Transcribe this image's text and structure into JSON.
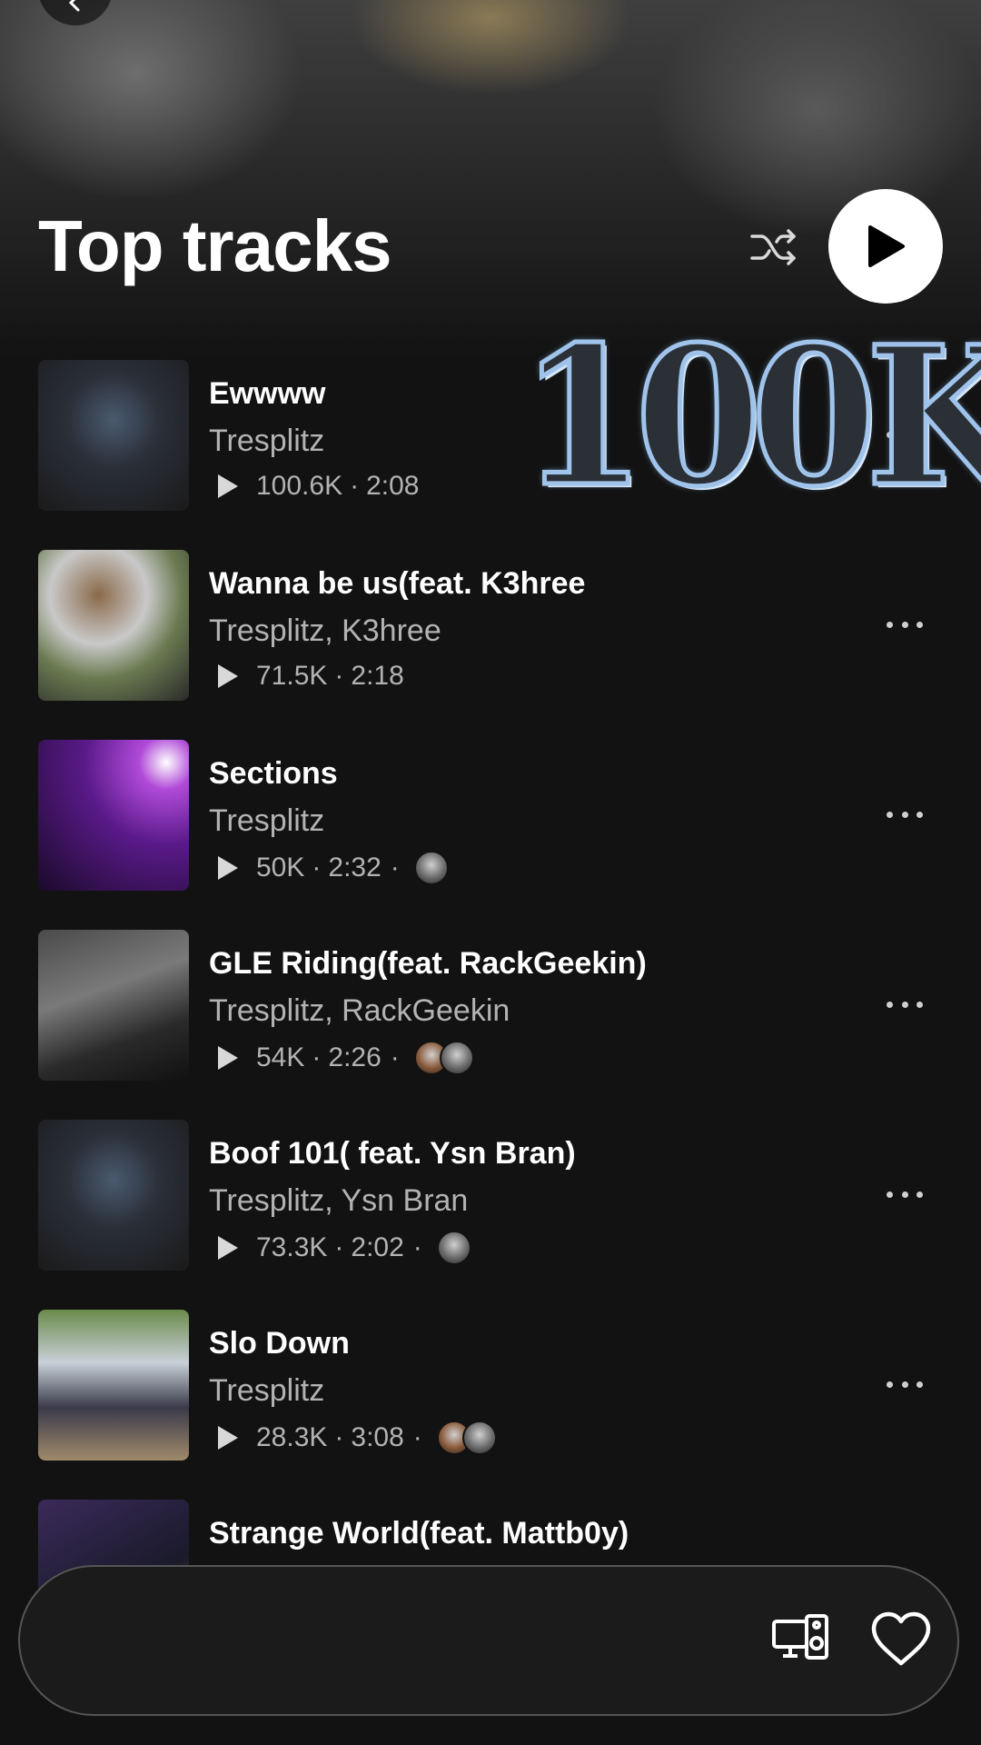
{
  "header": {
    "title": "Top tracks",
    "back_icon": "chevron-left-icon",
    "shuffle_icon": "shuffle-icon",
    "play_icon": "play-icon"
  },
  "sticker_text": "100K",
  "tracks": [
    {
      "title": "Ewwww",
      "artist": "Tresplitz",
      "plays": "100.6K",
      "duration": "2:08",
      "avatars": 0
    },
    {
      "title": "Wanna be us(feat. K3hree",
      "artist": "Tresplitz, K3hree",
      "plays": "71.5K",
      "duration": "2:18",
      "avatars": 0
    },
    {
      "title": "Sections",
      "artist": "Tresplitz",
      "plays": "50K",
      "duration": "2:32",
      "avatars": 1
    },
    {
      "title": "GLE Riding(feat. RackGeekin)",
      "artist": "Tresplitz, RackGeekin",
      "plays": "54K",
      "duration": "2:26",
      "avatars": 2
    },
    {
      "title": "Boof 101( feat. Ysn Bran)",
      "artist": "Tresplitz, Ysn Bran",
      "plays": "73.3K",
      "duration": "2:02",
      "avatars": 1
    },
    {
      "title": "Slo Down",
      "artist": "Tresplitz",
      "plays": "28.3K",
      "duration": "3:08",
      "avatars": 2
    },
    {
      "title": "Strange World(feat. Mattb0y)",
      "artist": "",
      "plays": "",
      "duration": "",
      "avatars": 0
    }
  ],
  "separator": "·",
  "mini_player": {
    "device_icon": "devices-icon",
    "heart_icon": "heart-outline-icon"
  },
  "colors": {
    "background": "#121212",
    "secondary_text": "#b3b3b3",
    "play_button": "#ffffff",
    "sticker_outline": "#9fc3ea"
  }
}
